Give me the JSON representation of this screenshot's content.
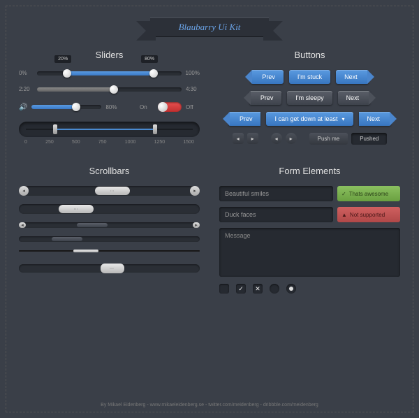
{
  "title": "Blaubarry Ui Kit",
  "sections": {
    "sliders": "Sliders",
    "buttons": "Buttons",
    "scrollbars": "Scrollbars",
    "forms": "Form Elements"
  },
  "sliders": {
    "s1": {
      "left": "0%",
      "right": "100%",
      "t1": "20%",
      "t2": "80%"
    },
    "s2": {
      "left": "2:20",
      "right": "4:30"
    },
    "s3": {
      "val": "80%",
      "on": "On",
      "off": "Off"
    },
    "range": {
      "ticks": [
        "0",
        "250",
        "500",
        "750",
        "1000",
        "1250",
        "1500"
      ]
    }
  },
  "buttons": {
    "row1": [
      "Prev",
      "I'm stuck",
      "Next"
    ],
    "row2": [
      "Prev",
      "I'm sleepy",
      "Next"
    ],
    "row3": [
      "Prev",
      "I can get down at least",
      "Next"
    ],
    "push": "Push me",
    "pushed": "Pushed"
  },
  "forms": {
    "input1": "Beautiful smiles",
    "ok": "Thats awesome",
    "input2": "Duck faces",
    "err": "Not supported",
    "msg": "Message"
  },
  "credits": "By Mikael Eidenberg - www.mikaeleidenberg.se - twitter.com/meidenberg - dribbble.com/meidenberg"
}
